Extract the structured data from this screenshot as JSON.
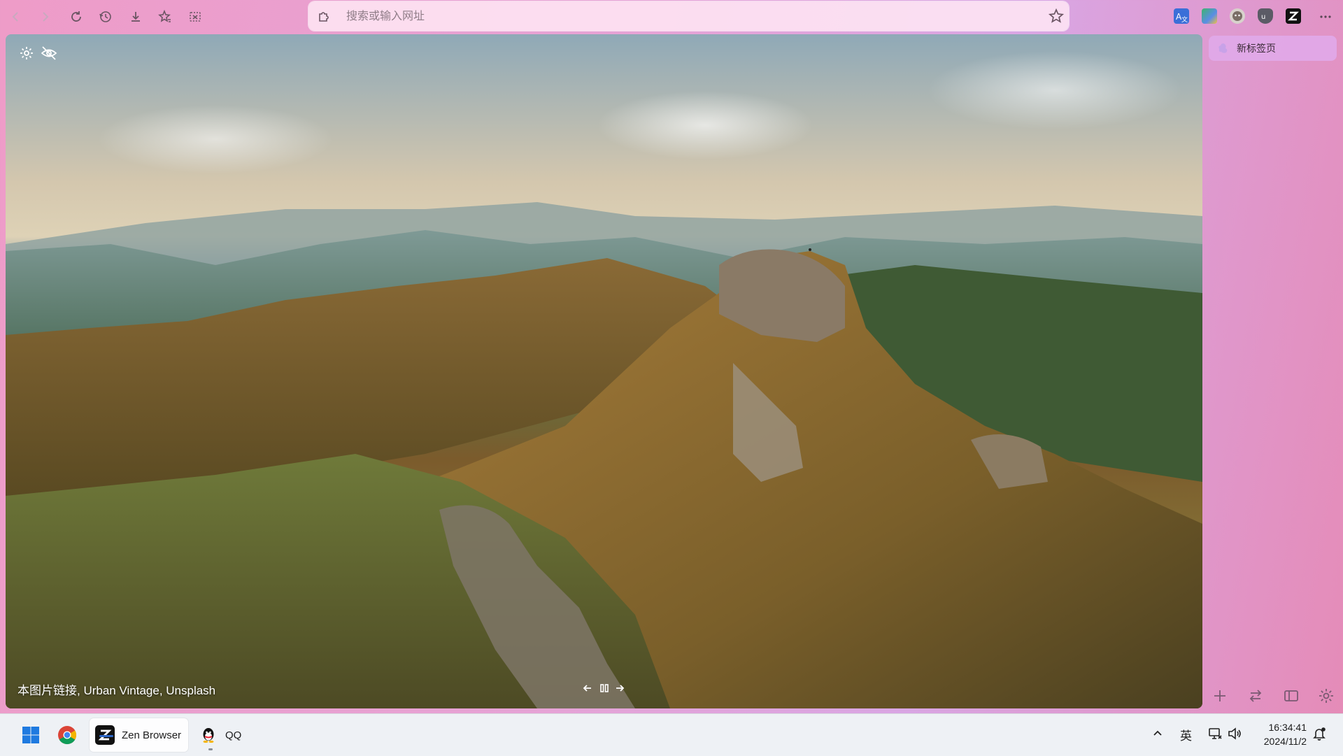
{
  "toolbar": {
    "back_icon": "back-arrow-icon",
    "forward_icon": "forward-arrow-icon",
    "reload_icon": "reload-icon",
    "history_icon": "history-icon",
    "downloads_icon": "download-icon",
    "bookmarks_icon": "star-list-icon",
    "screenshot_icon": "screenshot-icon",
    "more_icon": "more-dots-icon"
  },
  "urlbar": {
    "placeholder": "搜索或输入网址",
    "value": ""
  },
  "extensions": [
    "translate-extension-icon",
    "color-extension-icon",
    "monkey-extension-icon",
    "ublock-extension-icon",
    "zen-extension-icon"
  ],
  "newtab": {
    "image_credit": "本图片链接, Urban Vintage, Unsplash",
    "settings_icon": "gear-icon",
    "hide_icon": "eye-off-icon",
    "prev_icon": "arrow-left-icon",
    "pause_icon": "pause-icon",
    "next_icon": "arrow-right-icon"
  },
  "sidebar": {
    "tabs": [
      {
        "label": "新标签页"
      }
    ],
    "bottom_buttons": [
      "plus-icon",
      "switch-icon",
      "sidebar-toggle-icon",
      "gear-icon"
    ]
  },
  "taskbar": {
    "apps": [
      {
        "label": "",
        "icon": "chrome-icon"
      },
      {
        "label": "Zen Browser",
        "icon": "zen-browser-icon",
        "active": true
      },
      {
        "label": "QQ",
        "icon": "qq-icon"
      }
    ],
    "ime": "英",
    "time": "16:34:41",
    "date": "2024/11/2"
  },
  "colors": {
    "accent_pink": "#ee9cc8",
    "taskbar_bg": "#eef1f5",
    "windows_blue": "#2d67c7"
  }
}
